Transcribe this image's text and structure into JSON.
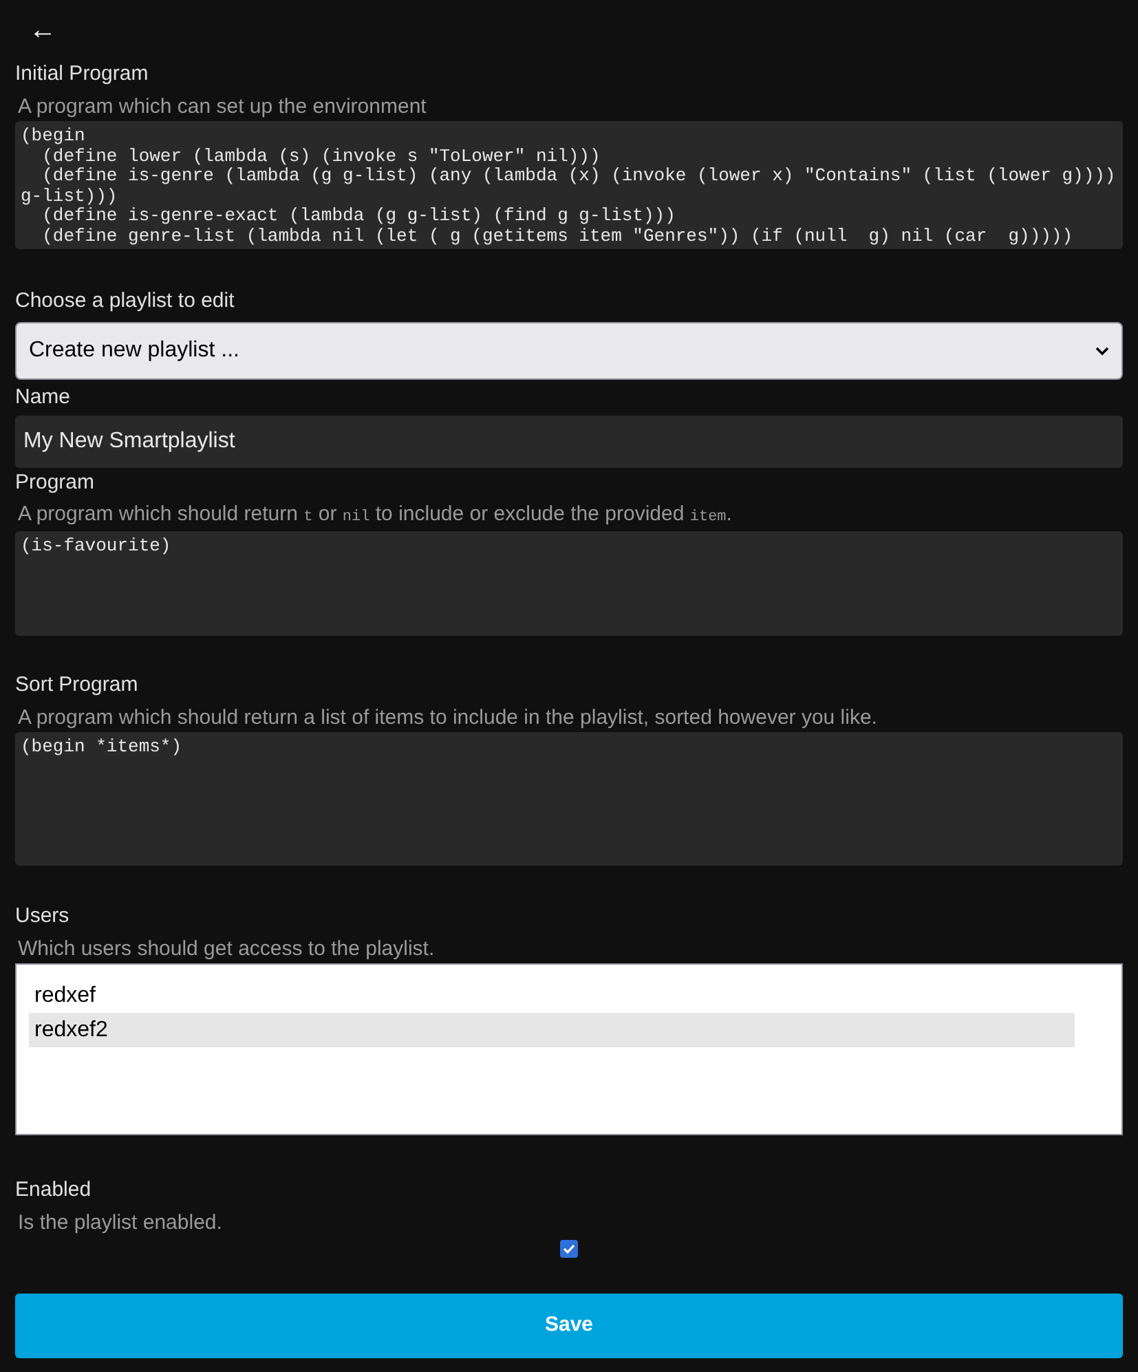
{
  "back_button": {
    "label": "←"
  },
  "initial_program": {
    "label": "Initial Program",
    "description": "A program which can set up the environment",
    "lines": [
      "(begin",
      "  (define lower (lambda (s) (invoke s \"ToLower\" nil)))",
      "  (define is-genre (lambda (g g-list) (any (lambda (x) (invoke (lower x) \"Contains\" (list (lower g))))",
      "g-list)))",
      "  (define is-genre-exact (lambda (g g-list) (find g g-list)))",
      "  (define genre-list (lambda nil (let ( g (getitems item \"Genres\")) (if (null  g) nil (car  g)))))"
    ]
  },
  "playlist_select": {
    "label": "Choose a playlist to edit",
    "value": "Create new playlist ..."
  },
  "name": {
    "label": "Name",
    "value": "My New Smartplaylist"
  },
  "program": {
    "label": "Program",
    "description": [
      {
        "kind": "text",
        "text": "A program which should return "
      },
      {
        "kind": "code",
        "text": "t"
      },
      {
        "kind": "text",
        "text": " or "
      },
      {
        "kind": "code",
        "text": "nil"
      },
      {
        "kind": "text",
        "text": " to include or exclude the provided "
      },
      {
        "kind": "code",
        "text": "item"
      },
      {
        "kind": "text",
        "text": "."
      }
    ],
    "lines": [
      "(is-favourite)"
    ]
  },
  "sort_program": {
    "label": "Sort Program",
    "description": "A program which should return a list of items to include in the playlist, sorted however you like.",
    "lines": [
      "(begin *items*)"
    ]
  },
  "users": {
    "label": "Users",
    "description": "Which users should get access to the playlist.",
    "options": [
      {
        "label": "redxef",
        "selected": false
      },
      {
        "label": "redxef2",
        "selected": true
      }
    ]
  },
  "enabled": {
    "label": "Enabled",
    "description": "Is the playlist enabled.",
    "checked": true
  },
  "save_button": {
    "label": "Save"
  }
}
